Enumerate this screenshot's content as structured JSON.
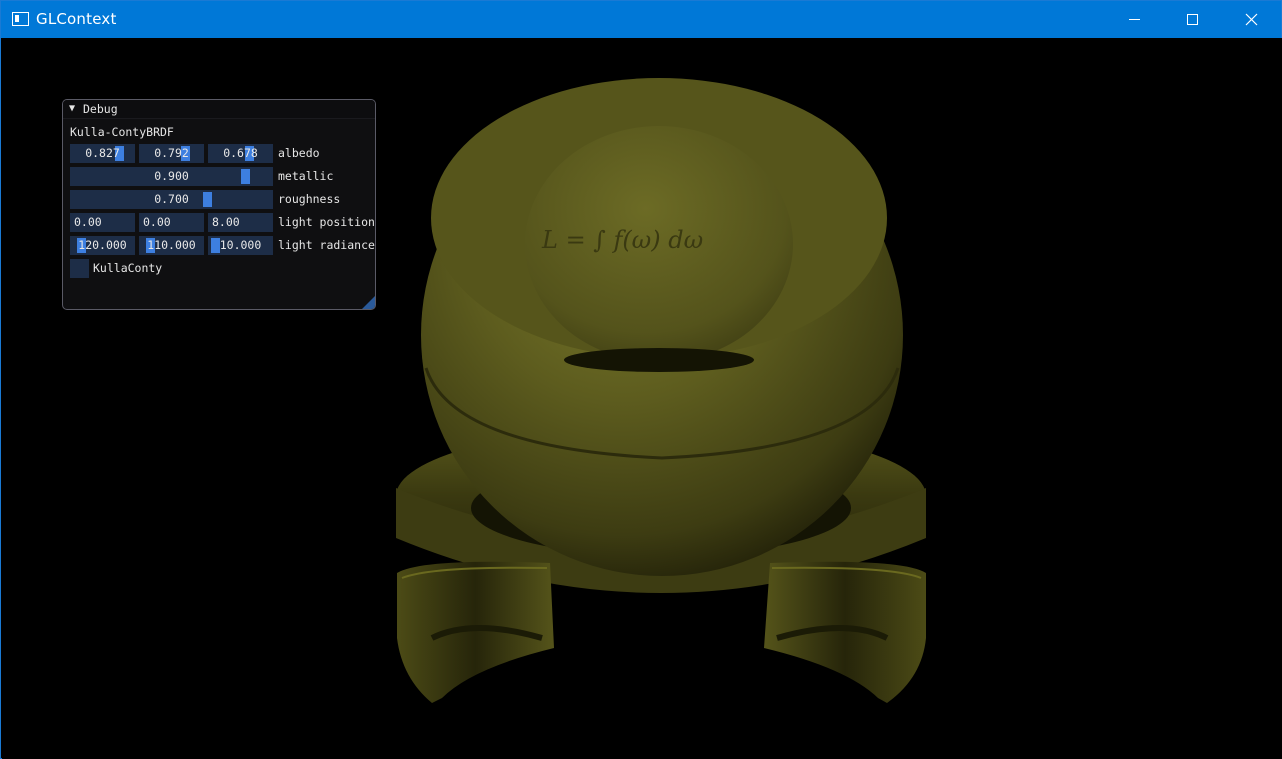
{
  "window": {
    "title": "GLContext"
  },
  "debug_panel": {
    "title": "Debug",
    "subtitle": "Kulla-ContyBRDF",
    "albedo": {
      "label": "albedo",
      "values": [
        "0.827",
        "0.792",
        "0.678"
      ]
    },
    "metallic": {
      "label": "metallic",
      "value": "0.900",
      "level": 0.9
    },
    "roughness": {
      "label": "roughness",
      "value": "0.700",
      "level": 0.7
    },
    "light_position": {
      "label": "light position",
      "values": [
        "0.00",
        "0.00",
        "8.00"
      ]
    },
    "light_radiance": {
      "label": "light radiance",
      "values": [
        "120.000",
        "110.000",
        "10.000"
      ]
    },
    "kullaconty_checkbox": {
      "label": "KullaConty",
      "checked": false
    }
  },
  "colors": {
    "titlebar": "#0078d7",
    "field_bg": "#1d2d47",
    "slider_grab": "#3d7fe0",
    "material": "#6b6a22"
  }
}
